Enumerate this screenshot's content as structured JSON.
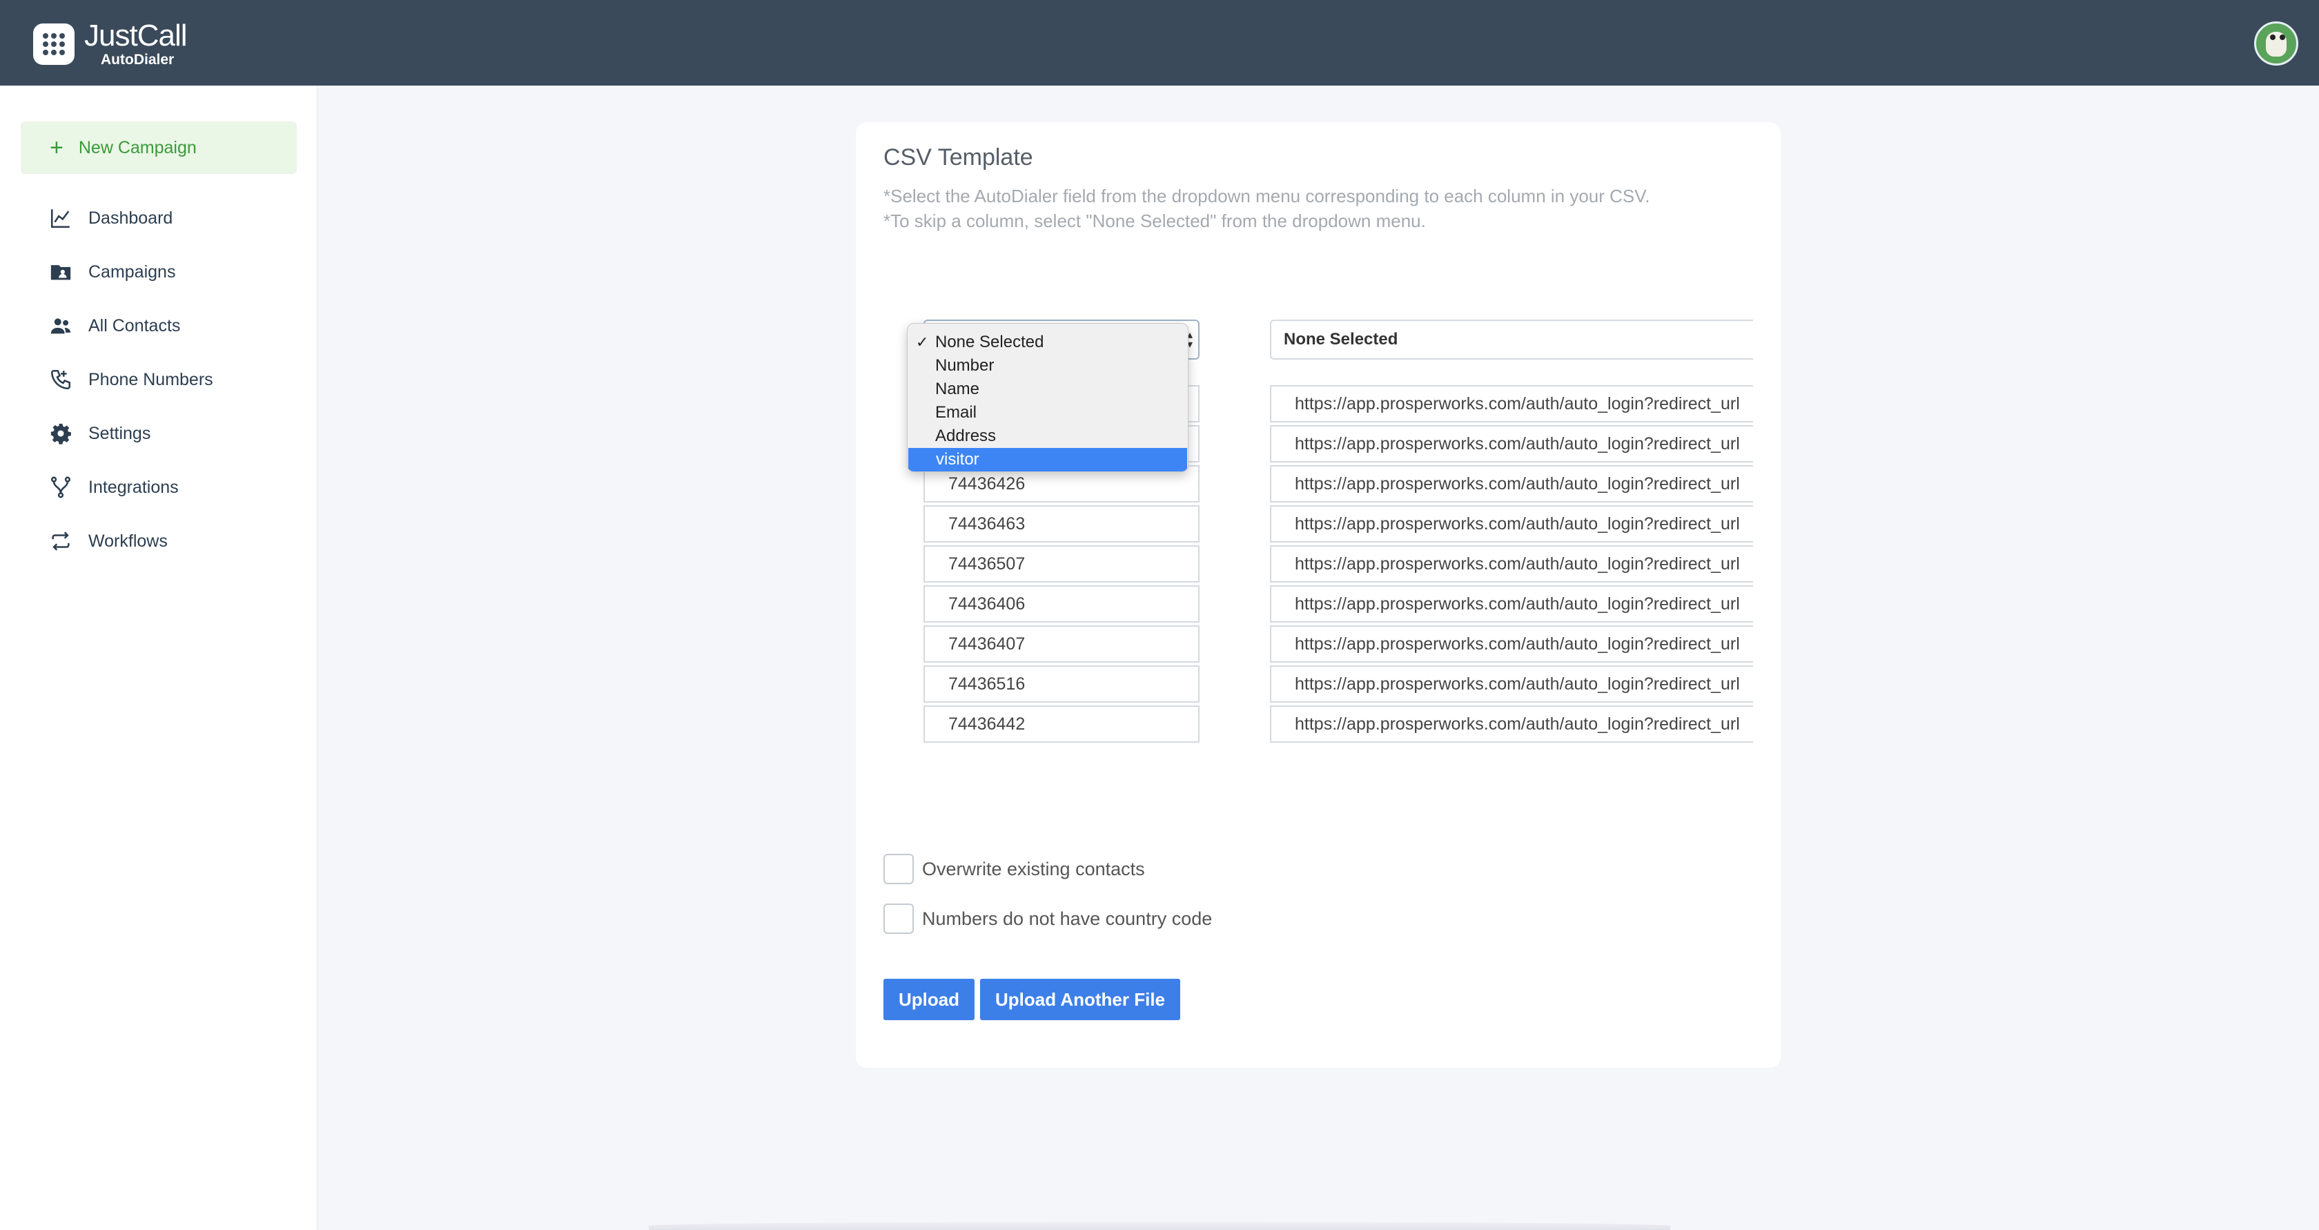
{
  "app": {
    "logo_name": "JustCall",
    "logo_sub": "AutoDialer"
  },
  "sidebar": {
    "new_campaign": "New Campaign",
    "items": [
      {
        "label": "Dashboard",
        "icon": "chart-line-icon"
      },
      {
        "label": "Campaigns",
        "icon": "folder-user-icon"
      },
      {
        "label": "All Contacts",
        "icon": "users-icon"
      },
      {
        "label": "Phone Numbers",
        "icon": "phone-icon"
      },
      {
        "label": "Settings",
        "icon": "gear-icon"
      },
      {
        "label": "Integrations",
        "icon": "branch-icon"
      },
      {
        "label": "Workflows",
        "icon": "repeat-icon"
      }
    ]
  },
  "card": {
    "title": "CSV Template",
    "hint1": "*Select the AutoDialer field from the dropdown menu corresponding to each column in your CSV.",
    "hint2": "*To skip a column, select \"None Selected\" from the dropdown menu.",
    "column2_selected": "None Selected",
    "dropdown_options": [
      "None Selected",
      "Number",
      "Name",
      "Email",
      "Address",
      "visitor"
    ],
    "dropdown_checked": "None Selected",
    "dropdown_highlighted": "visitor",
    "numbers": [
      "74436426",
      "74436463",
      "74436507",
      "74436406",
      "74436407",
      "74436516",
      "74436442"
    ],
    "urls": [
      "https://app.prosperworks.com/auth/auto_login?redirect_url",
      "https://app.prosperworks.com/auth/auto_login?redirect_url",
      "https://app.prosperworks.com/auth/auto_login?redirect_url",
      "https://app.prosperworks.com/auth/auto_login?redirect_url",
      "https://app.prosperworks.com/auth/auto_login?redirect_url",
      "https://app.prosperworks.com/auth/auto_login?redirect_url",
      "https://app.prosperworks.com/auth/auto_login?redirect_url",
      "https://app.prosperworks.com/auth/auto_login?redirect_url",
      "https://app.prosperworks.com/auth/auto_login?redirect_url"
    ],
    "overwrite_label": "Overwrite existing contacts",
    "no_country_code_label": "Numbers do not have country code",
    "upload_label": "Upload",
    "upload_another_label": "Upload Another File"
  },
  "colors": {
    "topbar": "#3a4a5b",
    "accent_green": "#3b9a3b",
    "button_blue": "#3d7fe8",
    "highlight_blue": "#3d85f5"
  }
}
